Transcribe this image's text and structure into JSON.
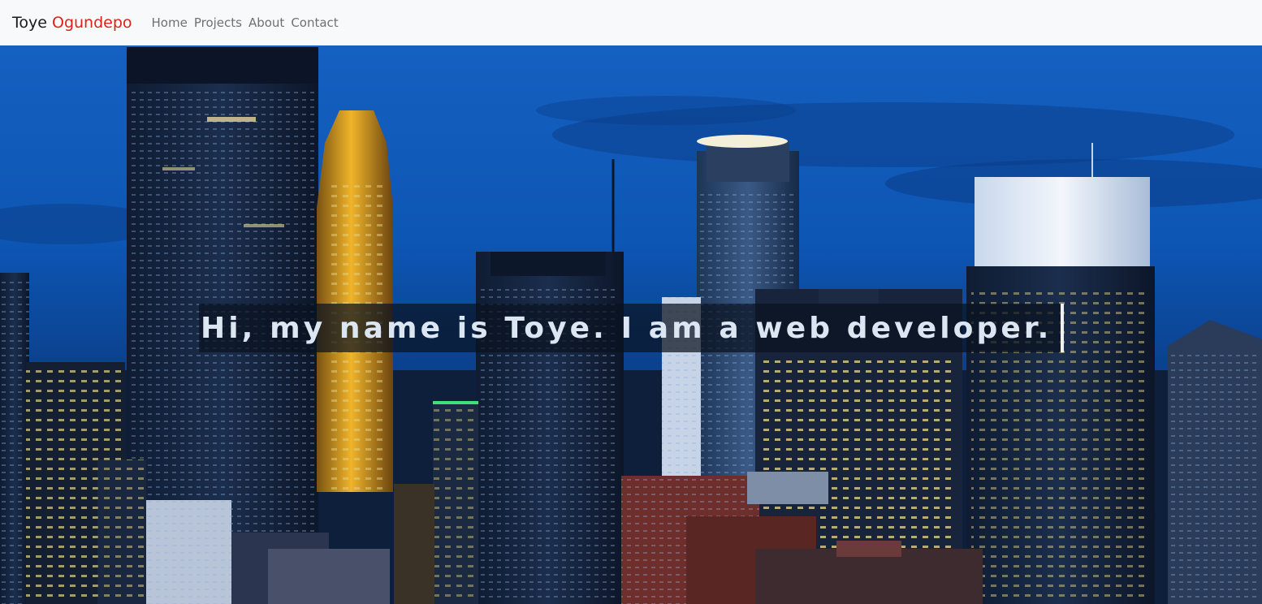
{
  "navbar": {
    "brand_first": "Toye",
    "brand_last": "Ogundepo",
    "links": [
      {
        "label": "Home"
      },
      {
        "label": "Projects"
      },
      {
        "label": "About"
      },
      {
        "label": "Contact"
      }
    ]
  },
  "hero": {
    "headline": "Hi, my name is Toye. I am a web developer.",
    "background": "night city skyline"
  },
  "colors": {
    "navbar_bg": "#f8f9fa",
    "brand_accent": "#e0201b",
    "nav_link": "#707070",
    "headline_text": "#dbe6f2"
  }
}
